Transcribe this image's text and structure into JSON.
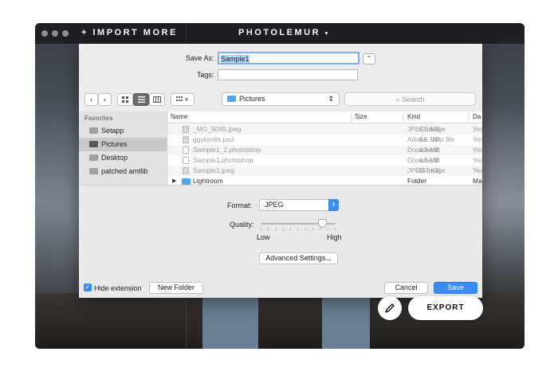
{
  "app": {
    "import_label": "+ IMPORT MORE",
    "brand": "PHOTOLEMUR",
    "brand_caret": "▾",
    "export_label": "EXPORT",
    "edit_icon": "pencil-icon"
  },
  "save_dialog": {
    "save_as_label": "Save As:",
    "save_as_value": "Sample1",
    "tags_label": "Tags:",
    "tags_value": "",
    "collapse_glyph": "⌃",
    "location": "Pictures",
    "location_arrows": "⇕",
    "search_placeholder": "Search",
    "search_glyph": "⌕",
    "sidebar": {
      "heading": "Favorites",
      "items": [
        {
          "label": "Setapp",
          "icon": "folder-icon"
        },
        {
          "label": "Pictures",
          "icon": "camera-icon",
          "selected": true
        },
        {
          "label": "Desktop",
          "icon": "desktop-icon"
        },
        {
          "label": "patched amtlib",
          "icon": "folder-icon"
        }
      ]
    },
    "columns": [
      "Name",
      "Size",
      "Kind",
      "Da"
    ],
    "files": [
      {
        "name": "_MG_5045.jpeg",
        "size": "4.5 MB",
        "kind": "JPEG image",
        "date": "Yes"
      },
      {
        "name": "ggykjvdls.psd",
        "size": "4.5 MB",
        "kind": "Adobe...hop file",
        "date": "Yes"
      },
      {
        "name": "Sample1_2.photoshop",
        "size": "4.3 MB",
        "kind": "Document",
        "date": "Yes"
      },
      {
        "name": "Sample1.photoshop",
        "size": "4.5 MB",
        "kind": "Document",
        "date": "Yes"
      },
      {
        "name": "Sample1.jpeg",
        "size": "467 KB",
        "kind": "JPEG image",
        "date": "Yes"
      },
      {
        "name": "Lightroom",
        "size": "",
        "kind": "Folder",
        "date": "Ma"
      }
    ],
    "format_label": "Format:",
    "format_value": "JPEG",
    "format_arrows": "⇕",
    "quality_label": "Quality:",
    "quality_low": "Low",
    "quality_high": "High",
    "quality_level": 0.82,
    "advanced_label": "Advanced Settings...",
    "hide_extension_label": "Hide extension",
    "hide_extension_checked": "✓",
    "new_folder_label": "New Folder",
    "cancel_label": "Cancel",
    "save_label": "Save",
    "nav_back": "‹",
    "nav_forward": "›"
  }
}
